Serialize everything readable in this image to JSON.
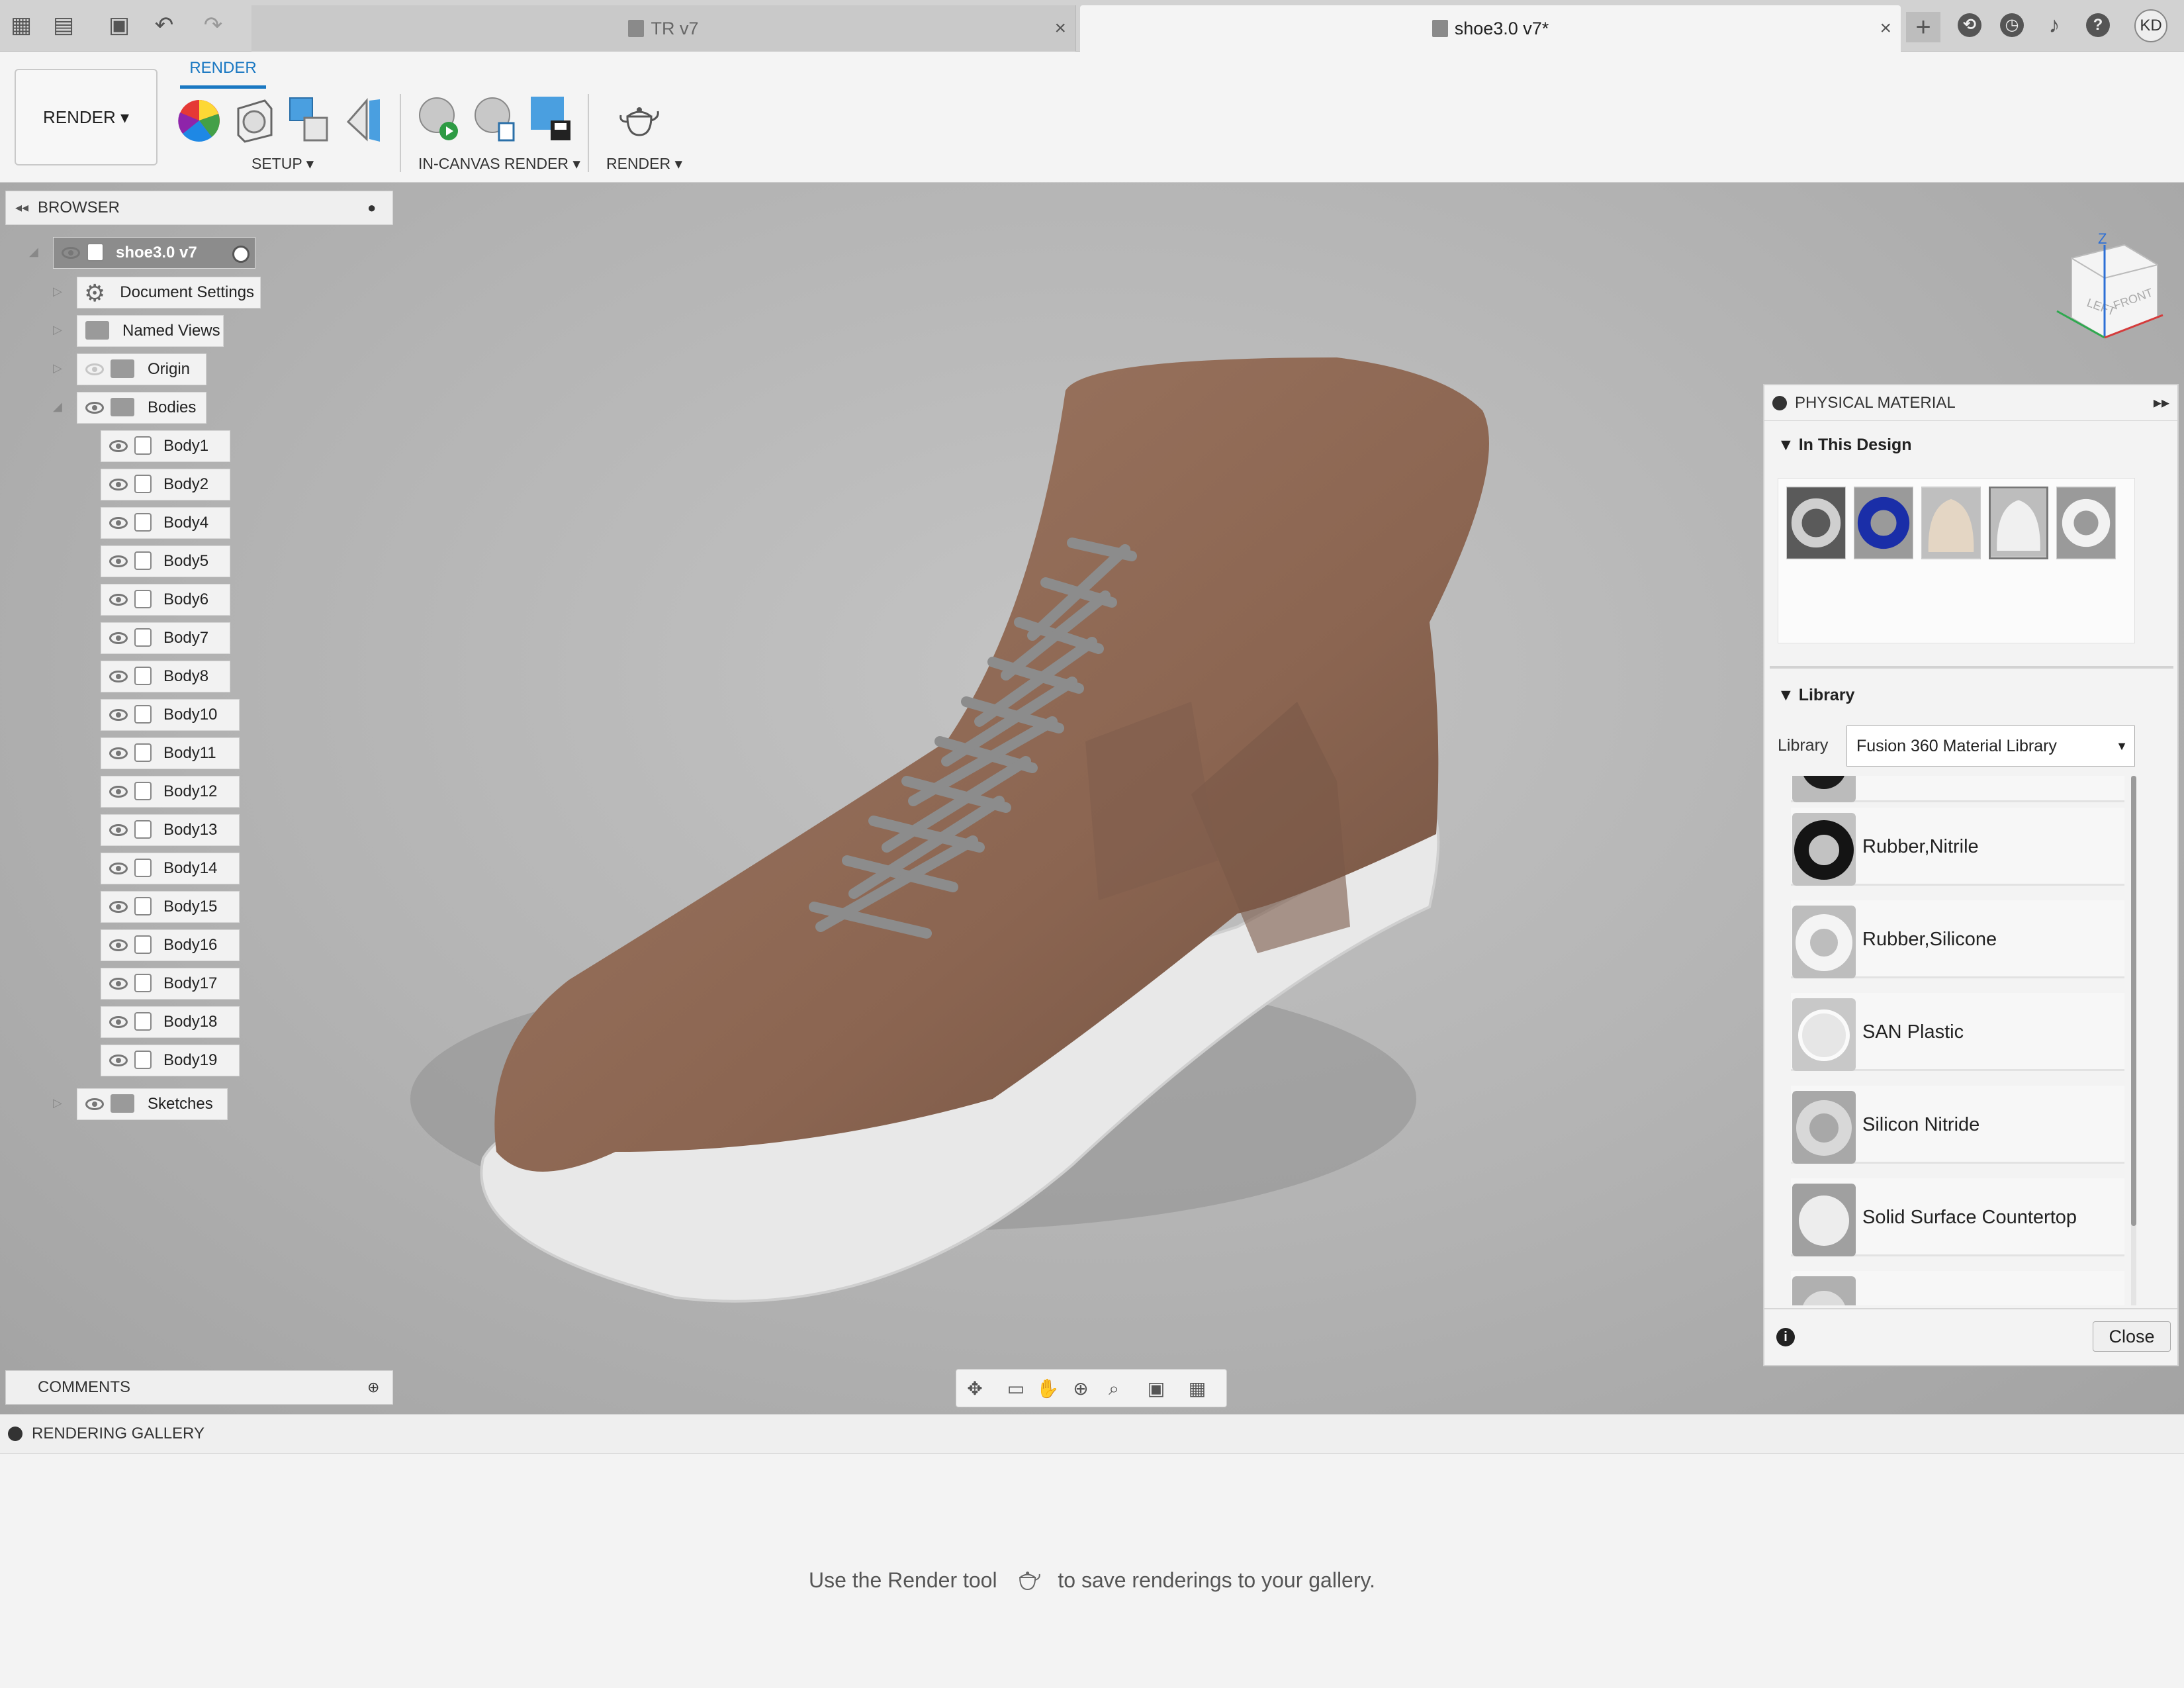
{
  "tabs": [
    {
      "label": "TR v7"
    },
    {
      "label": "shoe3.0 v7*"
    }
  ],
  "user": {
    "initials": "KD"
  },
  "ribbon": {
    "workspace_label": "RENDER ▾",
    "tab_label": "RENDER",
    "groups": {
      "setup": "SETUP ▾",
      "in_canvas": "IN-CANVAS RENDER ▾",
      "render": "RENDER ▾"
    }
  },
  "browser": {
    "title": "BROWSER",
    "root": "shoe3.0 v7",
    "items": {
      "doc_settings": "Document Settings",
      "named_views": "Named Views",
      "origin": "Origin",
      "bodies": "Bodies",
      "sketches": "Sketches"
    },
    "bodies": [
      "Body1",
      "Body2",
      "Body4",
      "Body5",
      "Body6",
      "Body7",
      "Body8",
      "Body10",
      "Body11",
      "Body12",
      "Body13",
      "Body14",
      "Body15",
      "Body16",
      "Body17",
      "Body18",
      "Body19"
    ]
  },
  "comments": {
    "title": "COMMENTS"
  },
  "viewcube": {
    "left": "LEFT",
    "front": "FRONT",
    "z": "Z"
  },
  "physical_material": {
    "title": "PHYSICAL MATERIAL",
    "in_design": "In This Design",
    "library_section": "Library",
    "library_label": "Library",
    "library_value": "Fusion 360 Material Library",
    "items": [
      "Rubber,Nitrile",
      "Rubber,Silicone",
      "SAN Plastic",
      "Silicon Nitride",
      "Solid Surface Countertop"
    ],
    "close_label": "Close"
  },
  "gallery": {
    "title": "RENDERING GALLERY",
    "message_a": "Use the Render tool",
    "message_b": "to save renderings to your gallery."
  },
  "colors": {
    "accent": "#1a78c2",
    "leather": "#8f6b57",
    "sole": "#e8e8e8",
    "laces": "#8c8c8c"
  }
}
